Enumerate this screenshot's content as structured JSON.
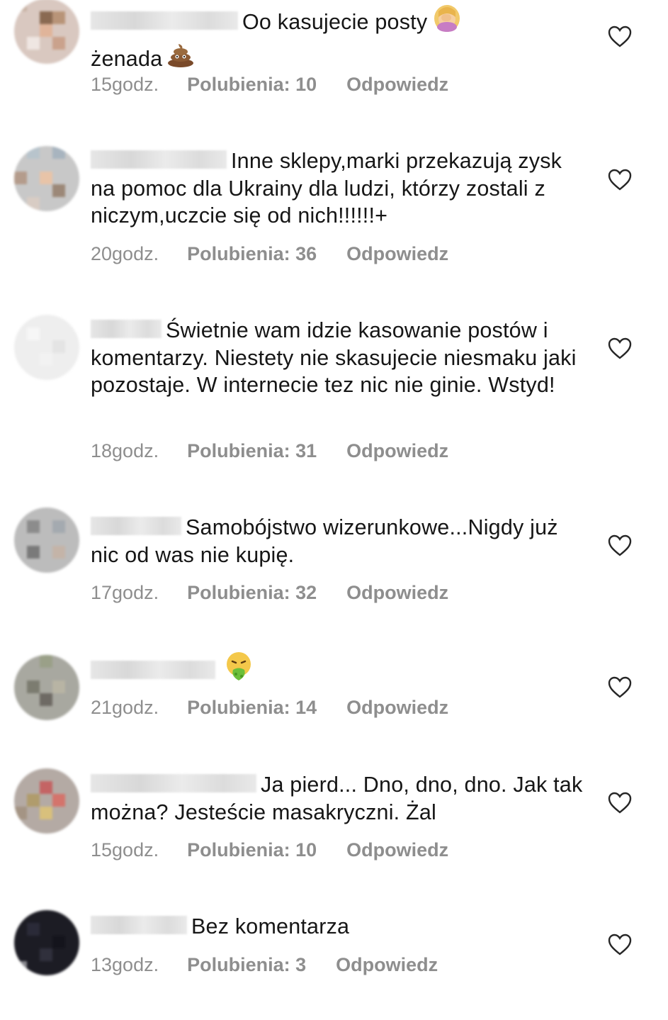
{
  "comments": [
    {
      "text": "Oo kasujecie posty",
      "text2": "żenada",
      "time": "15godz.",
      "likes": "Polubienia: 10",
      "reply": "Odpowiedz"
    },
    {
      "text": "Inne sklepy,marki przekazują zysk na pomoc dla Ukrainy dla ludzi, którzy zostali z niczym,uczcie się od nich!!!!!!+",
      "time": "20godz.",
      "likes": "Polubienia: 36",
      "reply": "Odpowiedz"
    },
    {
      "text": "Świetnie wam idzie kasowanie postów i komentarzy. Niestety nie skasujecie niesmaku jaki pozostaje. W internecie tez nic nie ginie. Wstyd!",
      "time": "18godz.",
      "likes": "Polubienia: 31",
      "reply": "Odpowiedz"
    },
    {
      "text": "Samobójstwo wizerunkowe...Nigdy już nic od was nie kupię.",
      "time": "17godz.",
      "likes": "Polubienia: 32",
      "reply": "Odpowiedz"
    },
    {
      "text": "",
      "time": "21godz.",
      "likes": "Polubienia: 14",
      "reply": "Odpowiedz"
    },
    {
      "text": "Ja pierd... Dno, dno, dno. Jak tak można? Jesteście masakryczni. Żal",
      "time": "15godz.",
      "likes": "Polubienia: 10",
      "reply": "Odpowiedz"
    },
    {
      "text": "Bez komentarza",
      "time": "13godz.",
      "likes": "Polubienia: 3",
      "reply": "Odpowiedz"
    }
  ],
  "icons": {
    "like": "heart-outline-icon",
    "facepalm": "woman-facepalming-emoji",
    "poop": "pile-of-poo-emoji",
    "vomit": "face-vomiting-emoji"
  },
  "colors": {
    "meta_text": "#8e8e8e",
    "body_text": "#161616"
  }
}
